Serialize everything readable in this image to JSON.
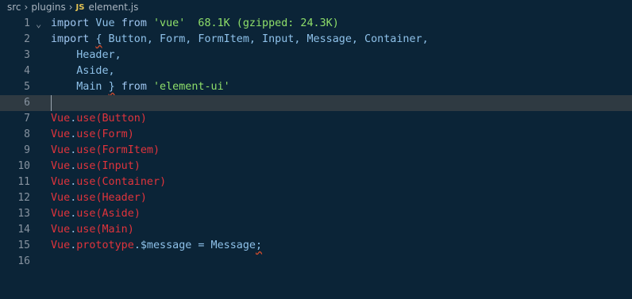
{
  "breadcrumb": {
    "items": [
      "src",
      "plugins"
    ],
    "file_badge": "JS",
    "file_name": "element.js"
  },
  "editor": {
    "lines": [
      {
        "num": "1",
        "parts": [
          [
            "kw",
            "import"
          ],
          [
            "id",
            " Vue "
          ],
          [
            "kw",
            "from"
          ],
          [
            "id",
            " "
          ],
          [
            "str",
            "'vue'"
          ],
          [
            "dim",
            "  68.1K (gzipped: 24.3K)"
          ]
        ]
      },
      {
        "num": "2",
        "parts": [
          [
            "kw",
            "import"
          ],
          [
            "id",
            " "
          ],
          [
            "brace",
            "{"
          ],
          [
            "id",
            " Button, Form, FormItem, Input, Message, Container,"
          ]
        ]
      },
      {
        "num": "3",
        "parts": [
          [
            "id",
            "    Header,"
          ]
        ]
      },
      {
        "num": "4",
        "parts": [
          [
            "id",
            "    Aside,"
          ]
        ]
      },
      {
        "num": "5",
        "parts": [
          [
            "id",
            "    Main "
          ],
          [
            "brace",
            "}"
          ],
          [
            "id",
            " "
          ],
          [
            "kw",
            "from"
          ],
          [
            "id",
            " "
          ],
          [
            "str",
            "'element-ui'"
          ]
        ]
      },
      {
        "num": "6",
        "parts": [],
        "current": true
      },
      {
        "num": "7",
        "parts": [
          [
            "red",
            "Vue"
          ],
          [
            "id",
            "."
          ],
          [
            "red",
            "use"
          ],
          [
            "red",
            "("
          ],
          [
            "red",
            "Button"
          ],
          [
            "red",
            ")"
          ]
        ]
      },
      {
        "num": "8",
        "parts": [
          [
            "red",
            "Vue"
          ],
          [
            "id",
            "."
          ],
          [
            "red",
            "use"
          ],
          [
            "red",
            "("
          ],
          [
            "red",
            "Form"
          ],
          [
            "red",
            ")"
          ]
        ]
      },
      {
        "num": "9",
        "parts": [
          [
            "red",
            "Vue"
          ],
          [
            "id",
            "."
          ],
          [
            "red",
            "use"
          ],
          [
            "red",
            "("
          ],
          [
            "red",
            "FormItem"
          ],
          [
            "red",
            ")"
          ]
        ]
      },
      {
        "num": "10",
        "parts": [
          [
            "red",
            "Vue"
          ],
          [
            "id",
            "."
          ],
          [
            "red",
            "use"
          ],
          [
            "red",
            "("
          ],
          [
            "red",
            "Input"
          ],
          [
            "red",
            ")"
          ]
        ]
      },
      {
        "num": "11",
        "parts": [
          [
            "red",
            "Vue"
          ],
          [
            "id",
            "."
          ],
          [
            "red",
            "use"
          ],
          [
            "red",
            "("
          ],
          [
            "red",
            "Container"
          ],
          [
            "red",
            ")"
          ]
        ]
      },
      {
        "num": "12",
        "parts": [
          [
            "red",
            "Vue"
          ],
          [
            "id",
            "."
          ],
          [
            "red",
            "use"
          ],
          [
            "red",
            "("
          ],
          [
            "red",
            "Header"
          ],
          [
            "red",
            ")"
          ]
        ]
      },
      {
        "num": "13",
        "parts": [
          [
            "red",
            "Vue"
          ],
          [
            "id",
            "."
          ],
          [
            "red",
            "use"
          ],
          [
            "red",
            "("
          ],
          [
            "red",
            "Aside"
          ],
          [
            "red",
            ")"
          ]
        ]
      },
      {
        "num": "14",
        "parts": [
          [
            "red",
            "Vue"
          ],
          [
            "id",
            "."
          ],
          [
            "red",
            "use"
          ],
          [
            "red",
            "("
          ],
          [
            "red",
            "Main"
          ],
          [
            "red",
            ")"
          ]
        ]
      },
      {
        "num": "15",
        "parts": [
          [
            "red",
            "Vue"
          ],
          [
            "id",
            "."
          ],
          [
            "red",
            "prototype"
          ],
          [
            "id",
            "."
          ],
          [
            "id",
            "$message = Message"
          ],
          [
            "brace",
            ";"
          ]
        ]
      },
      {
        "num": "16",
        "parts": []
      }
    ]
  },
  "colors": {
    "background": "#0b2437",
    "error_red": "#e0343c",
    "string_green": "#8fdf6a"
  }
}
